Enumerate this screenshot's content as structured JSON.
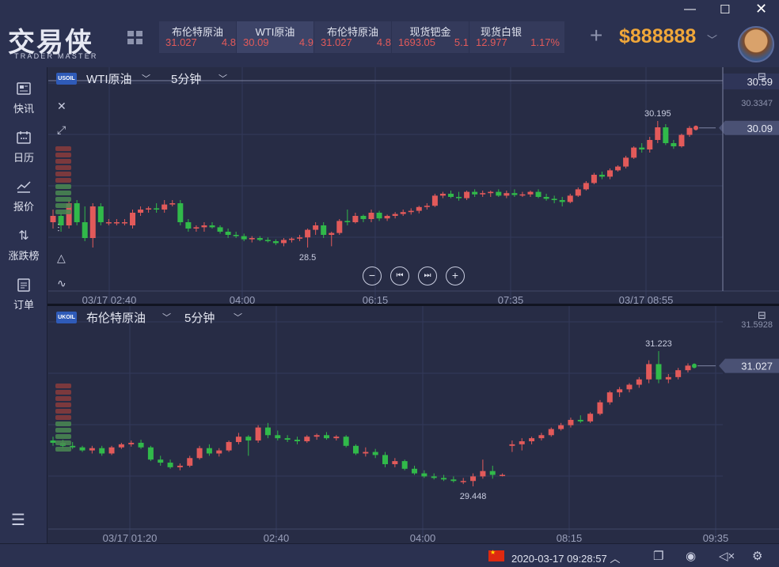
{
  "app": {
    "logo_cn": "交易侠",
    "logo_en": "TRADER MASTER",
    "balance": "$888888"
  },
  "tickers": [
    {
      "name": "布伦特原油",
      "price": "31.027",
      "change": "4.8"
    },
    {
      "name": "WTI原油",
      "price": "30.09",
      "change": "4.9"
    },
    {
      "name": "布伦特原油",
      "price": "31.027",
      "change": "4.8"
    },
    {
      "name": "现货钯金",
      "price": "1693.05",
      "change": "5.1"
    },
    {
      "name": "现货白银",
      "price": "12.977",
      "change": "1.17%"
    }
  ],
  "sidebar": {
    "items": [
      {
        "label": "快讯",
        "icon": "news-icon"
      },
      {
        "label": "日历",
        "icon": "calendar-icon"
      },
      {
        "label": "报价",
        "icon": "quote-chart-icon"
      },
      {
        "label": "涨跌榜",
        "icon": "updown-arrows-icon"
      },
      {
        "label": "订单",
        "icon": "order-icon"
      }
    ]
  },
  "charts": {
    "top": {
      "badge": "USOIL",
      "symbol": "WTI原油",
      "period": "5分钟",
      "price_tag_top": "30.59",
      "axis_label": "30.3347",
      "current_price": "30.09",
      "low_label": "28.5",
      "x_ticks": [
        "03/17 02:40",
        "04:00",
        "06:15",
        "07:35",
        "03/17 08:55"
      ]
    },
    "bottom": {
      "badge": "UKOIL",
      "symbol": "布伦特原油",
      "period": "5分钟",
      "axis_label": "31.5928",
      "current_price": "31.027",
      "x_ticks": [
        "03/17 01:20",
        "02:40",
        "04:00",
        "08:15",
        "09:35"
      ]
    }
  },
  "chart_data": [
    {
      "type": "candlestick",
      "title": "WTI原油",
      "max_annotation": "30.195",
      "min_annotation": "28.5",
      "current": 30.09,
      "up_color": "#e25a5a",
      "down_color": "#31b94a",
      "candles": [
        [
          28.6,
          28.8,
          28.5,
          28.7
        ],
        [
          28.7,
          28.75,
          28.45,
          28.55
        ],
        [
          28.55,
          28.95,
          28.5,
          28.9
        ],
        [
          28.9,
          28.95,
          28.55,
          28.6
        ],
        [
          28.6,
          28.85,
          28.3,
          28.35
        ],
        [
          28.35,
          28.9,
          28.2,
          28.85
        ],
        [
          28.85,
          28.9,
          28.55,
          28.6
        ],
        [
          28.6,
          28.65,
          28.55,
          28.6
        ],
        [
          28.6,
          28.65,
          28.55,
          28.6
        ],
        [
          28.6,
          28.65,
          28.55,
          28.6
        ],
        [
          28.55,
          28.8,
          28.5,
          28.75
        ],
        [
          28.75,
          28.85,
          28.7,
          28.8
        ],
        [
          28.8,
          28.85,
          28.75,
          28.82
        ],
        [
          28.82,
          28.9,
          28.75,
          28.8
        ],
        [
          28.8,
          28.95,
          28.75,
          28.88
        ],
        [
          28.88,
          28.95,
          28.85,
          28.9
        ],
        [
          28.9,
          28.95,
          28.55,
          28.6
        ],
        [
          28.6,
          28.65,
          28.45,
          28.5
        ],
        [
          28.5,
          28.55,
          28.45,
          28.52
        ],
        [
          28.52,
          28.6,
          28.45,
          28.55
        ],
        [
          28.55,
          28.6,
          28.5,
          28.52
        ],
        [
          28.52,
          28.55,
          28.42,
          28.45
        ],
        [
          28.45,
          28.5,
          28.35,
          28.4
        ],
        [
          28.4,
          28.45,
          28.35,
          28.38
        ],
        [
          28.38,
          28.42,
          28.3,
          28.33
        ],
        [
          28.33,
          28.38,
          28.28,
          28.35
        ],
        [
          28.35,
          28.38,
          28.3,
          28.32
        ],
        [
          28.32,
          28.36,
          28.28,
          28.3
        ],
        [
          28.3,
          28.33,
          28.24,
          28.27
        ],
        [
          28.27,
          28.35,
          28.22,
          28.32
        ],
        [
          28.32,
          28.36,
          28.28,
          28.34
        ],
        [
          28.34,
          28.4,
          28.3,
          28.36
        ],
        [
          28.36,
          28.5,
          28.2,
          28.48
        ],
        [
          28.48,
          28.6,
          28.4,
          28.55
        ],
        [
          28.55,
          28.6,
          28.35,
          28.4
        ],
        [
          28.4,
          28.45,
          28.22,
          28.43
        ],
        [
          28.43,
          28.65,
          28.4,
          28.62
        ],
        [
          28.62,
          28.8,
          28.55,
          28.6
        ],
        [
          28.6,
          28.75,
          28.58,
          28.7
        ],
        [
          28.7,
          28.72,
          28.6,
          28.65
        ],
        [
          28.65,
          28.8,
          28.6,
          28.75
        ],
        [
          28.75,
          28.78,
          28.62,
          28.66
        ],
        [
          28.66,
          28.72,
          28.62,
          28.7
        ],
        [
          28.7,
          28.76,
          28.66,
          28.73
        ],
        [
          28.73,
          28.8,
          28.7,
          28.76
        ],
        [
          28.76,
          28.82,
          28.72,
          28.78
        ],
        [
          28.78,
          28.86,
          28.74,
          28.84
        ],
        [
          28.84,
          28.9,
          28.8,
          28.86
        ],
        [
          28.86,
          29.05,
          28.84,
          29.02
        ],
        [
          29.02,
          29.08,
          28.98,
          29.05
        ],
        [
          29.05,
          29.1,
          28.98,
          29.0
        ],
        [
          29.0,
          29.08,
          28.94,
          28.98
        ],
        [
          28.98,
          29.1,
          28.95,
          29.08
        ],
        [
          29.08,
          29.12,
          29.0,
          29.04
        ],
        [
          29.04,
          29.1,
          29.0,
          29.06
        ],
        [
          29.06,
          29.1,
          29.0,
          29.08
        ],
        [
          29.08,
          29.12,
          29.0,
          29.02
        ],
        [
          29.02,
          29.1,
          28.98,
          29.06
        ],
        [
          29.06,
          29.12,
          29.0,
          29.03
        ],
        [
          29.03,
          29.08,
          29.0,
          29.04
        ],
        [
          29.04,
          29.1,
          29.0,
          29.08
        ],
        [
          29.08,
          29.12,
          28.98,
          29.0
        ],
        [
          29.0,
          29.05,
          28.94,
          28.97
        ],
        [
          28.97,
          29.02,
          28.9,
          28.95
        ],
        [
          28.95,
          29.0,
          28.85,
          28.92
        ],
        [
          28.92,
          29.05,
          28.9,
          29.02
        ],
        [
          29.02,
          29.15,
          29.0,
          29.12
        ],
        [
          29.12,
          29.25,
          29.1,
          29.22
        ],
        [
          29.22,
          29.38,
          29.2,
          29.35
        ],
        [
          29.35,
          29.4,
          29.28,
          29.32
        ],
        [
          29.32,
          29.45,
          29.28,
          29.42
        ],
        [
          29.42,
          29.5,
          29.4,
          29.48
        ],
        [
          29.48,
          29.65,
          29.45,
          29.62
        ],
        [
          29.62,
          29.8,
          29.6,
          29.78
        ],
        [
          29.78,
          29.85,
          29.7,
          29.75
        ],
        [
          29.75,
          29.95,
          29.7,
          29.9
        ],
        [
          29.9,
          30.2,
          29.85,
          30.1
        ],
        [
          30.1,
          30.15,
          29.82,
          29.85
        ],
        [
          29.85,
          29.9,
          29.76,
          29.8
        ],
        [
          29.8,
          30.0,
          29.78,
          29.98
        ],
        [
          29.98,
          30.12,
          29.95,
          30.09
        ]
      ]
    },
    {
      "type": "candlestick",
      "title": "布伦特原油",
      "max_annotation": "31.223",
      "min_annotation": "29.448",
      "current": 31.027,
      "up_color": "#e25a5a",
      "down_color": "#31b94a",
      "candles": [
        [
          30.05,
          30.1,
          29.98,
          30.02
        ],
        [
          30.02,
          30.06,
          29.95,
          29.98
        ],
        [
          29.98,
          30.03,
          29.94,
          29.96
        ],
        [
          29.96,
          29.98,
          29.9,
          29.92
        ],
        [
          29.92,
          29.98,
          29.88,
          29.95
        ],
        [
          29.95,
          29.98,
          29.85,
          29.88
        ],
        [
          29.88,
          29.98,
          29.86,
          29.96
        ],
        [
          29.96,
          30.02,
          29.94,
          30.0
        ],
        [
          30.0,
          30.05,
          29.97,
          30.02
        ],
        [
          30.02,
          30.06,
          29.94,
          29.96
        ],
        [
          29.96,
          29.98,
          29.78,
          29.8
        ],
        [
          29.8,
          29.85,
          29.72,
          29.76
        ],
        [
          29.76,
          29.8,
          29.68,
          29.7
        ],
        [
          29.7,
          29.75,
          29.66,
          29.72
        ],
        [
          29.72,
          29.85,
          29.7,
          29.82
        ],
        [
          29.82,
          29.98,
          29.8,
          29.95
        ],
        [
          29.95,
          30.0,
          29.85,
          29.88
        ],
        [
          29.88,
          29.95,
          29.84,
          29.92
        ],
        [
          29.92,
          30.05,
          29.9,
          30.03
        ],
        [
          30.03,
          30.15,
          30.0,
          30.1
        ],
        [
          30.1,
          30.12,
          29.85,
          30.05
        ],
        [
          30.05,
          30.25,
          30.02,
          30.22
        ],
        [
          30.22,
          30.28,
          30.08,
          30.12
        ],
        [
          30.12,
          30.18,
          30.05,
          30.08
        ],
        [
          30.08,
          30.12,
          30.03,
          30.06
        ],
        [
          30.06,
          30.1,
          30.0,
          30.04
        ],
        [
          30.04,
          30.12,
          30.02,
          30.1
        ],
        [
          30.1,
          30.14,
          30.06,
          30.12
        ],
        [
          30.12,
          30.16,
          30.06,
          30.08
        ],
        [
          30.08,
          30.12,
          30.05,
          30.1
        ],
        [
          30.1,
          30.12,
          29.96,
          29.98
        ],
        [
          29.98,
          30.0,
          29.86,
          29.88
        ],
        [
          29.88,
          29.96,
          29.84,
          29.9
        ],
        [
          29.9,
          29.94,
          29.82,
          29.86
        ],
        [
          29.86,
          29.9,
          29.7,
          29.74
        ],
        [
          29.74,
          29.82,
          29.7,
          29.78
        ],
        [
          29.78,
          29.8,
          29.66,
          29.68
        ],
        [
          29.68,
          29.72,
          29.6,
          29.62
        ],
        [
          29.62,
          29.66,
          29.56,
          29.58
        ],
        [
          29.58,
          29.62,
          29.54,
          29.56
        ],
        [
          29.56,
          29.6,
          29.52,
          29.54
        ],
        [
          29.54,
          29.58,
          29.5,
          29.52
        ],
        [
          29.52,
          29.56,
          29.48,
          29.52
        ],
        [
          29.52,
          29.62,
          29.45,
          29.58
        ],
        [
          29.58,
          29.8,
          29.55,
          29.65
        ],
        [
          29.65,
          29.72,
          29.55,
          29.6
        ],
        [
          29.6,
          29.62,
          29.58,
          29.6
        ],
        [
          29.98,
          30.05,
          29.9,
          30.0
        ],
        [
          30.0,
          30.08,
          29.92,
          30.04
        ],
        [
          30.04,
          30.1,
          30.0,
          30.08
        ],
        [
          30.08,
          30.15,
          30.05,
          30.12
        ],
        [
          30.12,
          30.22,
          30.1,
          30.2
        ],
        [
          30.2,
          30.28,
          30.18,
          30.25
        ],
        [
          30.25,
          30.35,
          30.22,
          30.32
        ],
        [
          30.32,
          30.38,
          30.28,
          30.3
        ],
        [
          30.3,
          30.42,
          30.28,
          30.4
        ],
        [
          30.4,
          30.58,
          30.38,
          30.55
        ],
        [
          30.55,
          30.7,
          30.52,
          30.68
        ],
        [
          30.68,
          30.75,
          30.62,
          30.72
        ],
        [
          30.72,
          30.8,
          30.68,
          30.78
        ],
        [
          30.78,
          30.88,
          30.74,
          30.85
        ],
        [
          30.85,
          31.1,
          30.8,
          31.05
        ],
        [
          31.05,
          31.22,
          30.8,
          30.85
        ],
        [
          30.85,
          30.92,
          30.8,
          30.88
        ],
        [
          30.88,
          31.0,
          30.85,
          30.97
        ],
        [
          30.97,
          31.06,
          30.94,
          31.03
        ]
      ]
    }
  ]
}
